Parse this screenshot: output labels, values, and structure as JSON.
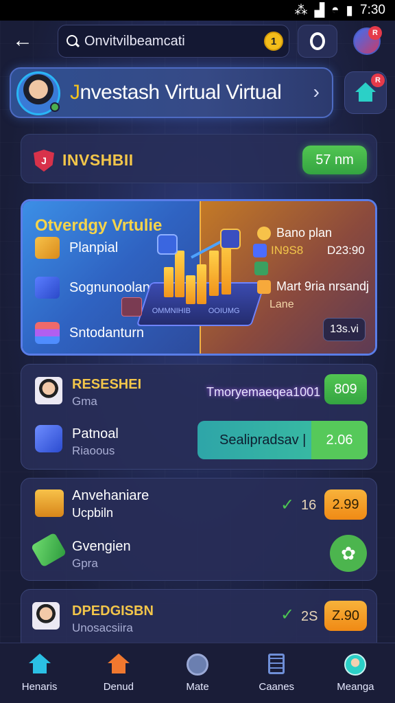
{
  "status": {
    "time": "7:30",
    "icons": [
      "vibrate-icon",
      "signal-icon",
      "wifi-icon",
      "battery-icon"
    ]
  },
  "search": {
    "value": "Onvitvilbeamcati",
    "coin_count": "1"
  },
  "profile": {
    "title_initial": "J",
    "title_rest": "nvestash Virtual Virtual"
  },
  "notification": {
    "count": "R"
  },
  "section": {
    "label": "INVSHBII",
    "value": "57 nm"
  },
  "overview": {
    "title": "Otverdgy Vrtulie",
    "items": [
      {
        "label": "Planpial"
      },
      {
        "label": "Sognunoolan"
      },
      {
        "label": "Sntodanturn"
      }
    ],
    "platform_left": "OMMNIHIB",
    "platform_right": "OOIUMG",
    "right": {
      "plan_label": "Bano plan",
      "val_gold": "IN9S8",
      "val_white": "D23:90",
      "mart_label": "Mart 9ria nrsandj",
      "lane_label": "Lane",
      "chip": "13s.vi"
    }
  },
  "card1": {
    "title": "RESESHEI",
    "sub": "Gma",
    "note": "Tmoryemaeqea1001",
    "badge": "809",
    "row2_title": "Patnoal",
    "row2_sub": "Riaoous",
    "teal_label": "Sealipradsav |",
    "teal_value": "2.06"
  },
  "card2": {
    "title": "Anvehaniare",
    "title2": "Ucpbiln",
    "check_value": "16",
    "badge": "2.99",
    "row2_title": "Gvengien",
    "row2_sub": "Gpra"
  },
  "card3": {
    "title": "DPEDGISBN",
    "sub": "Unosacsiira",
    "check_value": "2S",
    "badge": "Z.90"
  },
  "nav": [
    {
      "label": "Henaris",
      "icon": "home-icon",
      "color": "#2bc0e4"
    },
    {
      "label": "Denud",
      "icon": "house-icon",
      "color": "#f0782f"
    },
    {
      "label": "Mate",
      "icon": "gauge-icon",
      "color": "#6b7fb0"
    },
    {
      "label": "Caanes",
      "icon": "document-icon",
      "color": "#4b6cb8"
    },
    {
      "label": "Meanga",
      "icon": "profile-icon",
      "color": "#2bd0c7"
    }
  ]
}
